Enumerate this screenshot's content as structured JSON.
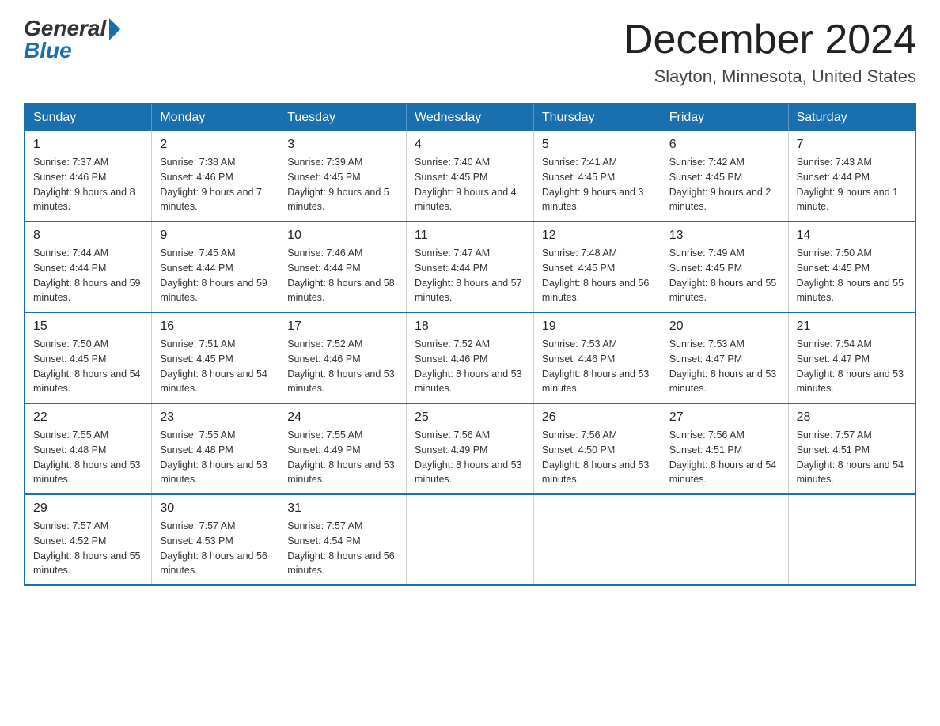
{
  "header": {
    "logo_general": "General",
    "logo_blue": "Blue",
    "month": "December 2024",
    "location": "Slayton, Minnesota, United States"
  },
  "days_of_week": [
    "Sunday",
    "Monday",
    "Tuesday",
    "Wednesday",
    "Thursday",
    "Friday",
    "Saturday"
  ],
  "weeks": [
    [
      {
        "day": "1",
        "sunrise": "7:37 AM",
        "sunset": "4:46 PM",
        "daylight": "9 hours and 8 minutes."
      },
      {
        "day": "2",
        "sunrise": "7:38 AM",
        "sunset": "4:46 PM",
        "daylight": "9 hours and 7 minutes."
      },
      {
        "day": "3",
        "sunrise": "7:39 AM",
        "sunset": "4:45 PM",
        "daylight": "9 hours and 5 minutes."
      },
      {
        "day": "4",
        "sunrise": "7:40 AM",
        "sunset": "4:45 PM",
        "daylight": "9 hours and 4 minutes."
      },
      {
        "day": "5",
        "sunrise": "7:41 AM",
        "sunset": "4:45 PM",
        "daylight": "9 hours and 3 minutes."
      },
      {
        "day": "6",
        "sunrise": "7:42 AM",
        "sunset": "4:45 PM",
        "daylight": "9 hours and 2 minutes."
      },
      {
        "day": "7",
        "sunrise": "7:43 AM",
        "sunset": "4:44 PM",
        "daylight": "9 hours and 1 minute."
      }
    ],
    [
      {
        "day": "8",
        "sunrise": "7:44 AM",
        "sunset": "4:44 PM",
        "daylight": "8 hours and 59 minutes."
      },
      {
        "day": "9",
        "sunrise": "7:45 AM",
        "sunset": "4:44 PM",
        "daylight": "8 hours and 59 minutes."
      },
      {
        "day": "10",
        "sunrise": "7:46 AM",
        "sunset": "4:44 PM",
        "daylight": "8 hours and 58 minutes."
      },
      {
        "day": "11",
        "sunrise": "7:47 AM",
        "sunset": "4:44 PM",
        "daylight": "8 hours and 57 minutes."
      },
      {
        "day": "12",
        "sunrise": "7:48 AM",
        "sunset": "4:45 PM",
        "daylight": "8 hours and 56 minutes."
      },
      {
        "day": "13",
        "sunrise": "7:49 AM",
        "sunset": "4:45 PM",
        "daylight": "8 hours and 55 minutes."
      },
      {
        "day": "14",
        "sunrise": "7:50 AM",
        "sunset": "4:45 PM",
        "daylight": "8 hours and 55 minutes."
      }
    ],
    [
      {
        "day": "15",
        "sunrise": "7:50 AM",
        "sunset": "4:45 PM",
        "daylight": "8 hours and 54 minutes."
      },
      {
        "day": "16",
        "sunrise": "7:51 AM",
        "sunset": "4:45 PM",
        "daylight": "8 hours and 54 minutes."
      },
      {
        "day": "17",
        "sunrise": "7:52 AM",
        "sunset": "4:46 PM",
        "daylight": "8 hours and 53 minutes."
      },
      {
        "day": "18",
        "sunrise": "7:52 AM",
        "sunset": "4:46 PM",
        "daylight": "8 hours and 53 minutes."
      },
      {
        "day": "19",
        "sunrise": "7:53 AM",
        "sunset": "4:46 PM",
        "daylight": "8 hours and 53 minutes."
      },
      {
        "day": "20",
        "sunrise": "7:53 AM",
        "sunset": "4:47 PM",
        "daylight": "8 hours and 53 minutes."
      },
      {
        "day": "21",
        "sunrise": "7:54 AM",
        "sunset": "4:47 PM",
        "daylight": "8 hours and 53 minutes."
      }
    ],
    [
      {
        "day": "22",
        "sunrise": "7:55 AM",
        "sunset": "4:48 PM",
        "daylight": "8 hours and 53 minutes."
      },
      {
        "day": "23",
        "sunrise": "7:55 AM",
        "sunset": "4:48 PM",
        "daylight": "8 hours and 53 minutes."
      },
      {
        "day": "24",
        "sunrise": "7:55 AM",
        "sunset": "4:49 PM",
        "daylight": "8 hours and 53 minutes."
      },
      {
        "day": "25",
        "sunrise": "7:56 AM",
        "sunset": "4:49 PM",
        "daylight": "8 hours and 53 minutes."
      },
      {
        "day": "26",
        "sunrise": "7:56 AM",
        "sunset": "4:50 PM",
        "daylight": "8 hours and 53 minutes."
      },
      {
        "day": "27",
        "sunrise": "7:56 AM",
        "sunset": "4:51 PM",
        "daylight": "8 hours and 54 minutes."
      },
      {
        "day": "28",
        "sunrise": "7:57 AM",
        "sunset": "4:51 PM",
        "daylight": "8 hours and 54 minutes."
      }
    ],
    [
      {
        "day": "29",
        "sunrise": "7:57 AM",
        "sunset": "4:52 PM",
        "daylight": "8 hours and 55 minutes."
      },
      {
        "day": "30",
        "sunrise": "7:57 AM",
        "sunset": "4:53 PM",
        "daylight": "8 hours and 56 minutes."
      },
      {
        "day": "31",
        "sunrise": "7:57 AM",
        "sunset": "4:54 PM",
        "daylight": "8 hours and 56 minutes."
      },
      null,
      null,
      null,
      null
    ]
  ]
}
